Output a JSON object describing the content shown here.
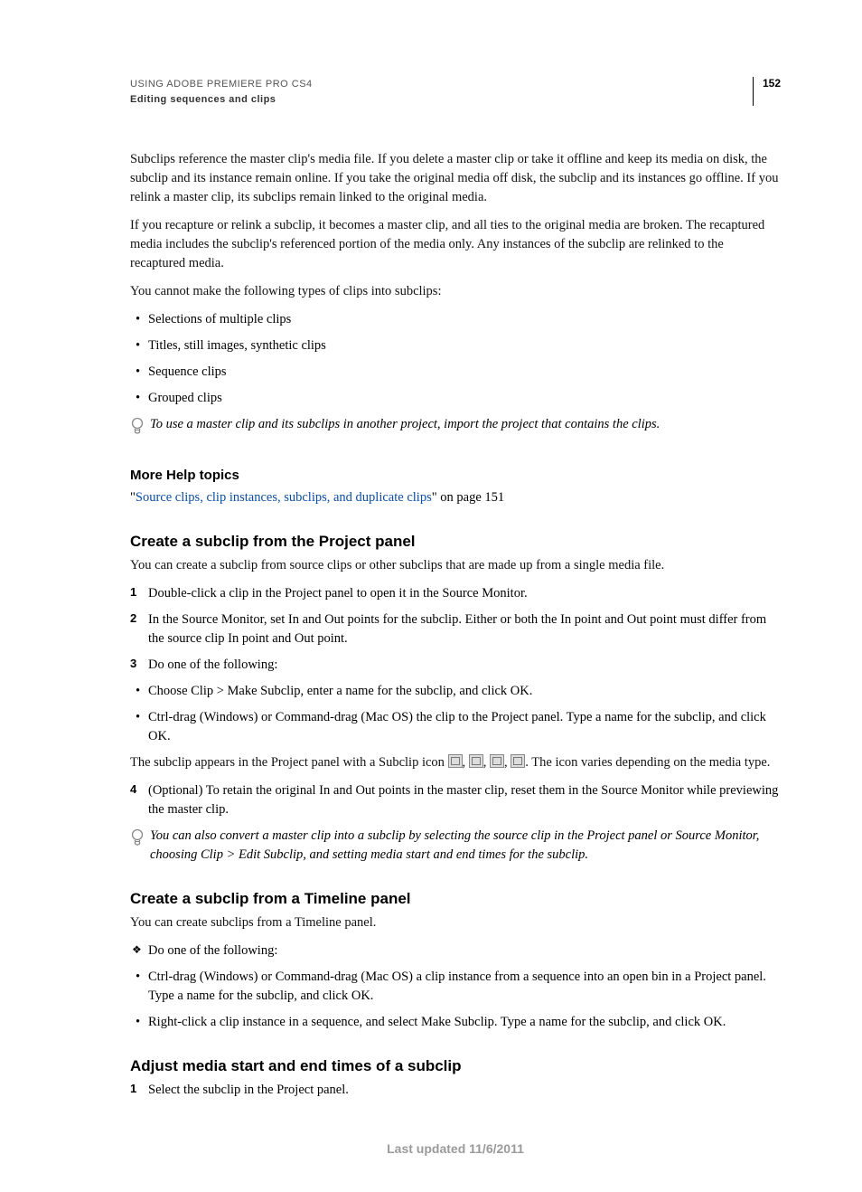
{
  "header": {
    "line1": "USING ADOBE PREMIERE PRO CS4",
    "line2": "Editing sequences and clips",
    "page_number": "152"
  },
  "intro_paragraphs": [
    "Subclips reference the master clip's media file. If you delete a master clip or take it offline and keep its media on disk, the subclip and its instance remain online. If you take the original media off disk, the subclip and its instances go offline. If you relink a master clip, its subclips remain linked to the original media.",
    "If you recapture or relink a subclip, it becomes a master clip, and all ties to the original media are broken. The recaptured media includes the subclip's referenced portion of the media only. Any instances of the subclip are relinked to the recaptured media.",
    "You cannot make the following types of clips into subclips:"
  ],
  "cannot_subclip_list": [
    "Selections of multiple clips",
    "Titles, still images, synthetic clips",
    "Sequence clips",
    "Grouped clips"
  ],
  "tip1": "To use a master clip and its subclips in another project, import the project that contains the clips.",
  "more_help": {
    "heading": "More Help topics",
    "link_text": "Source clips, clip instances, subclips, and duplicate clips",
    "link_suffix": " on page 151"
  },
  "section_project": {
    "heading": "Create a subclip from the Project panel",
    "intro": "You can create a subclip from source clips or other subclips that are made up from a single media file.",
    "steps": [
      "Double-click a clip in the Project panel to open it in the Source Monitor.",
      "In the Source Monitor, set In and Out points for the subclip. Either or both the In point and Out point must differ from the source clip In point and Out point.",
      "Do one of the following:"
    ],
    "sub_bullets": [
      "Choose Clip > Make Subclip, enter a name for the subclip, and click OK.",
      "Ctrl-drag (Windows) or Command-drag (Mac OS) the clip to the Project panel. Type a name for the subclip, and click OK."
    ],
    "after_bullets_prefix": "The subclip appears in the Project panel with a Subclip icon ",
    "after_bullets_suffix": ". The icon varies depending on the media type.",
    "step4": "(Optional) To retain the original In and Out points in the master clip, reset them in the Source Monitor while previewing the master clip.",
    "tip2": "You can also convert a master clip into a subclip by selecting the source clip in the Project panel or Source Monitor, choosing Clip > Edit Subclip, and setting media start and end times for the subclip."
  },
  "section_timeline": {
    "heading": "Create a subclip from a Timeline panel",
    "intro": "You can create subclips from a Timeline panel.",
    "instruction": "Do one of the following:",
    "bullets": [
      "Ctrl-drag (Windows) or Command-drag (Mac OS) a clip instance from a sequence into an open bin in a Project panel. Type a name for the subclip, and click OK.",
      "Right-click a clip instance in a sequence, and select Make Subclip. Type a name for the subclip, and click OK."
    ]
  },
  "section_adjust": {
    "heading": "Adjust media start and end times of a subclip",
    "step1": "Select the subclip in the Project panel."
  },
  "footer": "Last updated 11/6/2011"
}
